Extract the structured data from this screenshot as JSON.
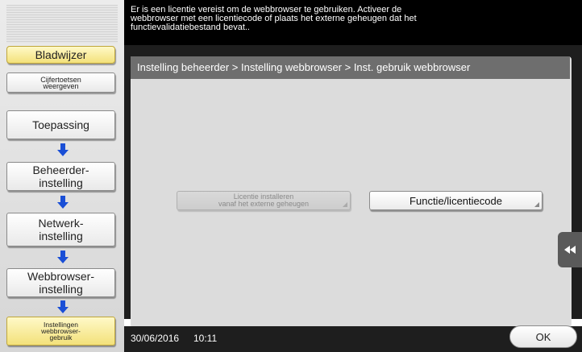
{
  "message": "Er is een licentie vereist om de webbrowser te gebruiken. Activeer de\nwebbrowser met een licentiecode of plaats het externe geheugen dat het\nfunctievalidatiebestand bevat..",
  "sidebar": {
    "bookmark_label": "Bladwijzer",
    "keypad_label": "Cijfertoetsen\nweergeven",
    "steps": [
      {
        "label": "Toepassing"
      },
      {
        "label": "Beheerder-\ninstelling"
      },
      {
        "label": "Netwerk-\ninstelling"
      },
      {
        "label": "Webbrowser-\ninstelling"
      }
    ],
    "current_label": "Instellingen\nwebbrowser-\ngebruik",
    "arrow_color": "#1a4fd6"
  },
  "breadcrumb": "Instelling beheerder > Instelling webbrowser > Inst. gebruik webbrowser",
  "buttons": {
    "install_external": "Licentie installeren\nvanaf het externe geheugen",
    "function_license": "Functie/licentiecode",
    "ok": "OK"
  },
  "side_tab_icon": "double-left-arrow-icon",
  "footer": {
    "date": "30/06/2016",
    "time": "10:11"
  }
}
